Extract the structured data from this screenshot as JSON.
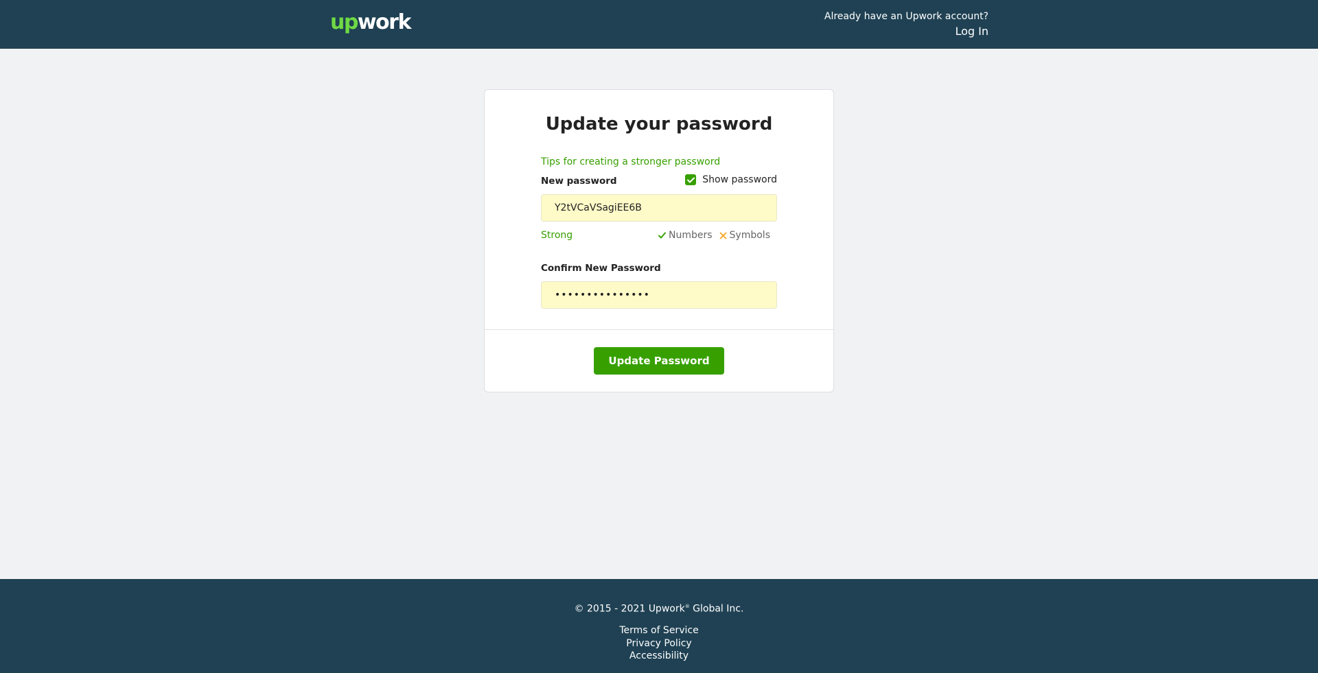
{
  "header": {
    "logo_up": "up",
    "logo_work": "work",
    "account_question": "Already have an Upwork account?",
    "login_label": "Log In"
  },
  "form": {
    "title": "Update your password",
    "tips_link": "Tips for creating a stronger password",
    "new_password_label": "New password",
    "show_password_label": "Show password",
    "show_password_checked": true,
    "new_password_value": "Y2tVCaVSagiEE6B",
    "strength_label": "Strong",
    "criteria": [
      {
        "label": "Numbers",
        "status": "met",
        "icon": "check-icon"
      },
      {
        "label": "Symbols",
        "status": "unmet",
        "icon": "cross-icon"
      }
    ],
    "confirm_password_label": "Confirm New Password",
    "confirm_password_value": "•••••••••••••••",
    "submit_label": "Update Password"
  },
  "footer": {
    "copyright_prefix": "© 2015 - 2021 Upwork",
    "copyright_mark": "®",
    "copyright_suffix": " Global Inc.",
    "links": [
      "Terms of Service",
      "Privacy Policy",
      "Accessibility"
    ]
  },
  "colors": {
    "header_bg": "#1f4153",
    "brand_green": "#37a000",
    "logo_green": "#6fda44",
    "input_autofill_bg": "#fefbc8",
    "warning_orange": "#f5a623"
  }
}
